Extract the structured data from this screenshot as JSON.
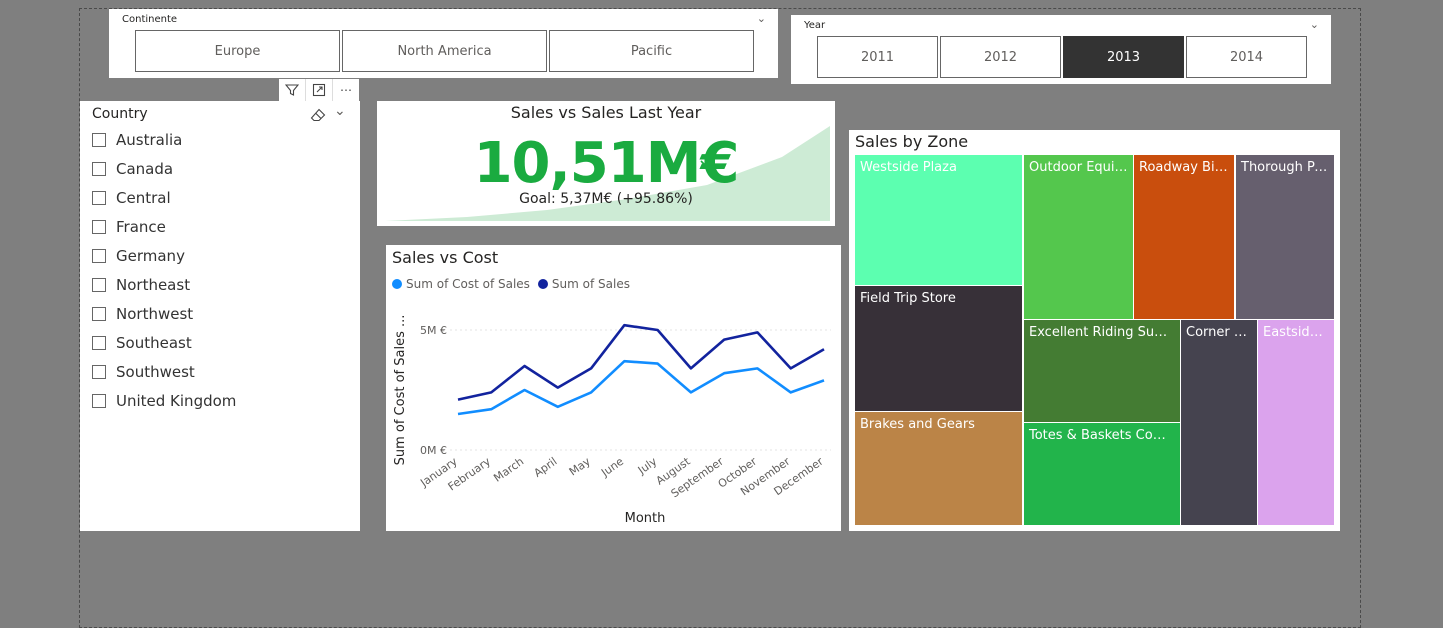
{
  "continent_slicer": {
    "title": "Continente",
    "options": [
      "Europe",
      "North America",
      "Pacific"
    ]
  },
  "year_slicer": {
    "title": "Year",
    "options": [
      "2011",
      "2012",
      "2013",
      "2014"
    ],
    "selected": "2013"
  },
  "country_slicer": {
    "title": "Country",
    "items": [
      "Australia",
      "Canada",
      "Central",
      "France",
      "Germany",
      "Northeast",
      "Northwest",
      "Southeast",
      "Southwest",
      "United Kingdom"
    ]
  },
  "kpi": {
    "title": "Sales vs Sales Last Year",
    "value": "10,51M€",
    "goal": "Goal: 5,37M€ (+95.86%)",
    "color": "#1aab40"
  },
  "chart_data": {
    "type": "line",
    "title": "Sales vs Cost",
    "categories": [
      "January",
      "February",
      "March",
      "April",
      "May",
      "June",
      "July",
      "August",
      "September",
      "October",
      "November",
      "December"
    ],
    "series": [
      {
        "name": "Sum of Cost of Sales",
        "color": "#118dff",
        "values": [
          1.5,
          1.7,
          2.5,
          1.8,
          2.4,
          3.7,
          3.6,
          2.4,
          3.2,
          3.4,
          2.4,
          2.9
        ]
      },
      {
        "name": "Sum of Sales",
        "color": "#12239e",
        "values": [
          2.1,
          2.4,
          3.5,
          2.6,
          3.4,
          5.2,
          5.0,
          3.4,
          4.6,
          4.9,
          3.4,
          4.2
        ]
      }
    ],
    "xlabel": "Month",
    "ylabel": "Sum of Cost of Sales ...",
    "yticks": [
      "5M €",
      "0M €"
    ],
    "ylim": [
      0,
      5
    ],
    "grid": true,
    "legend": "top-left"
  },
  "treemap": {
    "title": "Sales by Zone",
    "cells": [
      {
        "label": "Westside Plaza",
        "color": "#5cffb0"
      },
      {
        "label": "Field Trip Store",
        "color": "#373038"
      },
      {
        "label": "Brakes and Gears",
        "color": "#bb8447"
      },
      {
        "label": "Outdoor Equip...",
        "color": "#54c74d"
      },
      {
        "label": "Roadway Bicy...",
        "color": "#c94e0d"
      },
      {
        "label": "Thorough Par...",
        "color": "#665f6e"
      },
      {
        "label": "Excellent Riding Supplies",
        "color": "#447c33"
      },
      {
        "label": "Totes & Baskets Compa...",
        "color": "#22b44b"
      },
      {
        "label": "Corner Bi...",
        "color": "#45434f"
      },
      {
        "label": "Eastside ...",
        "color": "#dba3ed"
      }
    ]
  }
}
